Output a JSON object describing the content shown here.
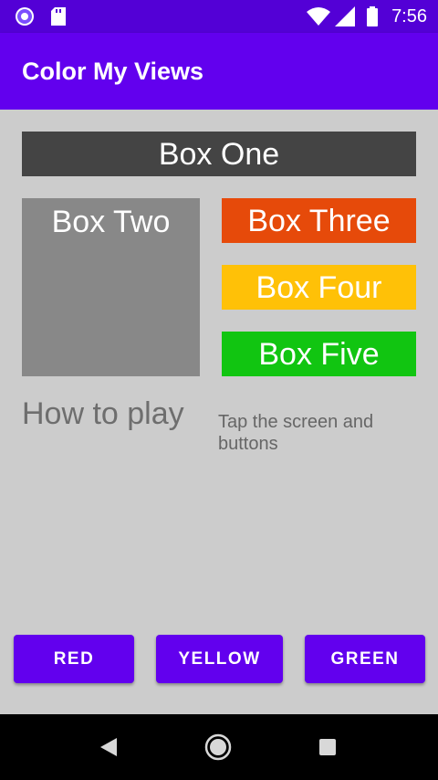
{
  "status_bar": {
    "time": "7:56",
    "background": "#5300d6",
    "left_icons": [
      "spinner-icon",
      "sd-card-icon"
    ],
    "right_icons": [
      "wifi-icon",
      "signal-icon",
      "battery-icon"
    ]
  },
  "app_bar": {
    "title": "Color My Views",
    "background": "#6200ee"
  },
  "boxes": {
    "one": {
      "label": "Box One",
      "color": "#444444"
    },
    "two": {
      "label": "Box Two",
      "color": "#888888"
    },
    "three": {
      "label": "Box Three",
      "color": "#e64a0a"
    },
    "four": {
      "label": "Box Four",
      "color": "#ffc107"
    },
    "five": {
      "label": "Box Five",
      "color": "#11c511"
    }
  },
  "instructions": {
    "label": "How to play",
    "info": "Tap the screen and buttons"
  },
  "buttons": {
    "red": "RED",
    "yellow": "YELLOW",
    "green": "GREEN",
    "color": "#6200ee"
  },
  "colors": {
    "screen_background": "#cccccc",
    "nav_bar": "#000000"
  },
  "nav_bar": {
    "icons": [
      "back-icon",
      "home-icon",
      "recents-icon"
    ]
  }
}
